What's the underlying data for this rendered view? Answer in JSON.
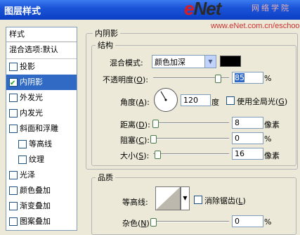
{
  "window": {
    "title": "图层样式"
  },
  "watermark": {
    "logo_e": "e",
    "logo_rest": "Net",
    "cn": "网络学院",
    "url": "www.eNet.com.cn/eschool"
  },
  "sidebar": {
    "header": "样式",
    "items": [
      {
        "label": "混合选项:默认",
        "checkbox": false,
        "checked": false,
        "indent": false,
        "selected": false
      },
      {
        "label": "投影",
        "checkbox": true,
        "checked": false,
        "indent": false,
        "selected": false
      },
      {
        "label": "内阴影",
        "checkbox": true,
        "checked": true,
        "indent": false,
        "selected": true
      },
      {
        "label": "外发光",
        "checkbox": true,
        "checked": false,
        "indent": false,
        "selected": false
      },
      {
        "label": "内发光",
        "checkbox": true,
        "checked": false,
        "indent": false,
        "selected": false
      },
      {
        "label": "斜面和浮雕",
        "checkbox": true,
        "checked": false,
        "indent": false,
        "selected": false
      },
      {
        "label": "等高线",
        "checkbox": true,
        "checked": false,
        "indent": true,
        "selected": false
      },
      {
        "label": "纹理",
        "checkbox": true,
        "checked": false,
        "indent": true,
        "selected": false
      },
      {
        "label": "光泽",
        "checkbox": true,
        "checked": false,
        "indent": false,
        "selected": false
      },
      {
        "label": "颜色叠加",
        "checkbox": true,
        "checked": false,
        "indent": false,
        "selected": false
      },
      {
        "label": "渐变叠加",
        "checkbox": true,
        "checked": false,
        "indent": false,
        "selected": false
      },
      {
        "label": "图案叠加",
        "checkbox": true,
        "checked": false,
        "indent": false,
        "selected": false
      }
    ]
  },
  "panel": {
    "title": "内阴影",
    "structure": {
      "title": "结构",
      "blend_mode": {
        "label": "混合模式:",
        "value": "颜色加深",
        "swatch": "#000000"
      },
      "opacity": {
        "label": "不透明度",
        "key": "O",
        "value": "85",
        "unit": "%",
        "level": 85
      },
      "angle": {
        "label": "角度",
        "key": "A",
        "value": "120",
        "unit": "度",
        "degrees": 120
      },
      "global_light": {
        "label": "使用全局光",
        "key": "G",
        "checked": false
      },
      "distance": {
        "label": "距离",
        "key": "D",
        "value": "8",
        "unit": "像素",
        "level": 3
      },
      "choke": {
        "label": "阻塞",
        "key": "C",
        "value": "0",
        "unit": "%",
        "level": 0
      },
      "size": {
        "label": "大小",
        "key": "S",
        "value": "16",
        "unit": "像素",
        "level": 6
      }
    },
    "quality": {
      "title": "品质",
      "contour": {
        "label": "等高线:"
      },
      "antialias": {
        "label": "消除锯齿",
        "key": "L",
        "checked": false
      },
      "noise": {
        "label": "杂色",
        "key": "N",
        "value": "0",
        "unit": "%",
        "level": 0
      }
    }
  }
}
